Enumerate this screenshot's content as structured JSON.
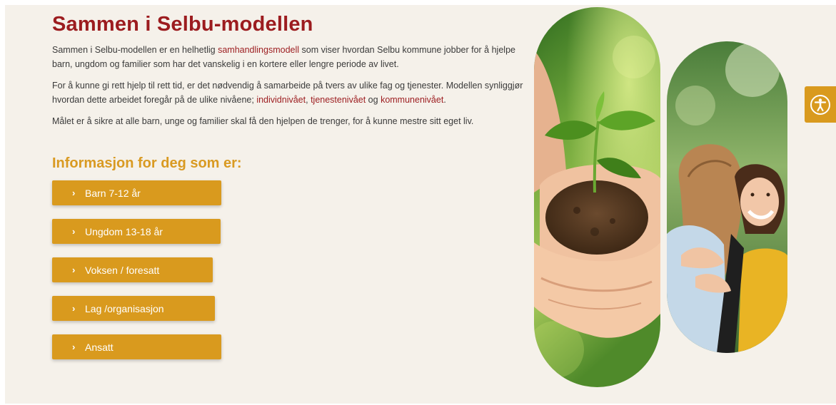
{
  "heading": "Sammen i Selbu-modellen",
  "intro": {
    "before_link": "Sammen i Selbu-modellen er en helhetlig ",
    "link": "samhandlingsmodell",
    "after_link": " som viser hvordan Selbu kommune jobber for å hjelpe barn, ungdom og familier som har det vanskelig i en kortere eller lengre periode av livet."
  },
  "levels": {
    "text": "For å kunne gi rett hjelp til rett tid, er det nødvendig å samarbeide på tvers av ulike fag og tjenester. Modellen synliggjør hvordan dette arbeidet foregår på de ulike nivåene; ",
    "link_individ": "individnivået",
    "comma": ", ",
    "link_tjeneste": "tjenestenivået",
    "and": " og ",
    "link_kommune": "kommunenivået",
    "period": "."
  },
  "goal": "Målet er å sikre at alle barn, unge og familier skal få den hjelpen de trenger, for å kunne mestre sitt eget liv.",
  "info_heading": "Informasjon for deg som er:",
  "buttons": [
    {
      "label": "Barn 7-12 år",
      "icon": "chevron-right-icon"
    },
    {
      "label": "Ungdom 13-18 år",
      "icon": "chevron-right-icon"
    },
    {
      "label": "Voksen / foresatt",
      "icon": "chevron-right-icon"
    },
    {
      "label": "Lag /organisasjon",
      "icon": "chevron-right-icon"
    },
    {
      "label": "Ansatt",
      "icon": "chevron-right-icon"
    }
  ],
  "images": [
    {
      "name": "seedling-in-soil-hands-photo"
    },
    {
      "name": "hugging-girls-photo"
    }
  ],
  "accessibility": {
    "icon": "accessibility-icon"
  },
  "colors": {
    "heading": "#9c1c1f",
    "accent": "#d99a1e",
    "background": "#f5f1ea",
    "text": "#3a3a3a"
  }
}
